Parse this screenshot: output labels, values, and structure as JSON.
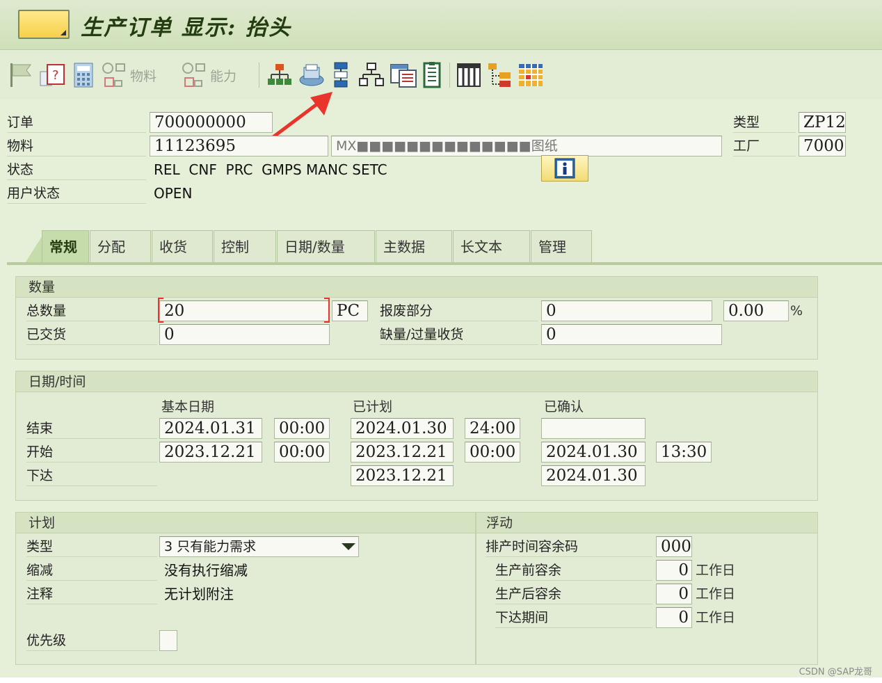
{
  "window": {
    "title": "生产订单 显示: 抬头"
  },
  "toolbar": {
    "buttons": [
      {
        "name": "flag-icon"
      },
      {
        "name": "document-help-icon"
      },
      {
        "name": "calculator-icon"
      },
      {
        "name": "material-icon",
        "label": "物料"
      },
      {
        "name": "capacity-icon",
        "label": "能力"
      },
      {
        "name": "hierarchy-icon"
      },
      {
        "name": "printer-icon"
      },
      {
        "name": "sequence-icon"
      },
      {
        "name": "network-icon"
      },
      {
        "name": "document-list-icon"
      },
      {
        "name": "component-list-icon"
      },
      {
        "name": "columns-icon"
      },
      {
        "name": "tree-icon"
      },
      {
        "name": "grid-icon"
      }
    ]
  },
  "header": {
    "order_label": "订单",
    "order_value": "700000000",
    "material_label": "物料",
    "material_value": "11123695",
    "material_desc": "MX■■■■■■■■■■■■■■图纸",
    "status_label": "状态",
    "status_value": "REL  CNF  PRC  GMPS MANC SETC",
    "user_status_label": "用户状态",
    "user_status_value": "OPEN",
    "type_label": "类型",
    "type_value": "ZP12",
    "plant_label": "工厂",
    "plant_value": "7000"
  },
  "tabs": [
    {
      "label": "常规",
      "active": true
    },
    {
      "label": "分配"
    },
    {
      "label": "收货"
    },
    {
      "label": "控制"
    },
    {
      "label": "日期/数量"
    },
    {
      "label": "主数据"
    },
    {
      "label": "长文本"
    },
    {
      "label": "管理"
    }
  ],
  "quantity": {
    "title": "数量",
    "total_label": "总数量",
    "total_value": "20",
    "unit": "PC",
    "delivered_label": "已交货",
    "delivered_value": "0",
    "scrap_label": "报废部分",
    "scrap_value": "0",
    "scrap_pct": "0.00",
    "pct_sign": "%",
    "short_over_label": "缺量/过量收货",
    "short_over_value": "0"
  },
  "dates": {
    "title": "日期/时间",
    "col_basic": "基本日期",
    "col_scheduled": "已计划",
    "col_confirmed": "已确认",
    "end_label": "结束",
    "start_label": "开始",
    "release_label": "下达",
    "end_basic_date": "2024.01.31",
    "end_basic_time": "00:00",
    "end_sched_date": "2024.01.30",
    "end_sched_time": "24:00",
    "end_conf_date": "",
    "start_basic_date": "2023.12.21",
    "start_basic_time": "00:00",
    "start_sched_date": "2023.12.21",
    "start_sched_time": "00:00",
    "start_conf_date": "2024.01.30",
    "start_conf_time": "13:30",
    "release_sched_date": "2023.12.21",
    "release_conf_date": "2024.01.30"
  },
  "planning": {
    "title": "计划",
    "type_label": "类型",
    "type_value": "3 只有能力需求",
    "reduction_label": "缩减",
    "reduction_value": "没有执行缩减",
    "note_label": "注释",
    "note_value": "无计划附注",
    "priority_label": "优先级"
  },
  "float": {
    "title": "浮动",
    "sched_margin_label": "排产时间容余码",
    "sched_margin_value": "000",
    "pre_float_label": "生产前容余",
    "pre_float_value": "0",
    "post_float_label": "生产后容余",
    "post_float_value": "0",
    "release_period_label": "下达期间",
    "release_period_value": "0",
    "workday_unit": "工作日"
  },
  "watermark": "CSDN @SAP龙哥",
  "colors": {
    "background": "#e6f0d9",
    "title": "#243d10",
    "arrow": "#e8342a"
  }
}
